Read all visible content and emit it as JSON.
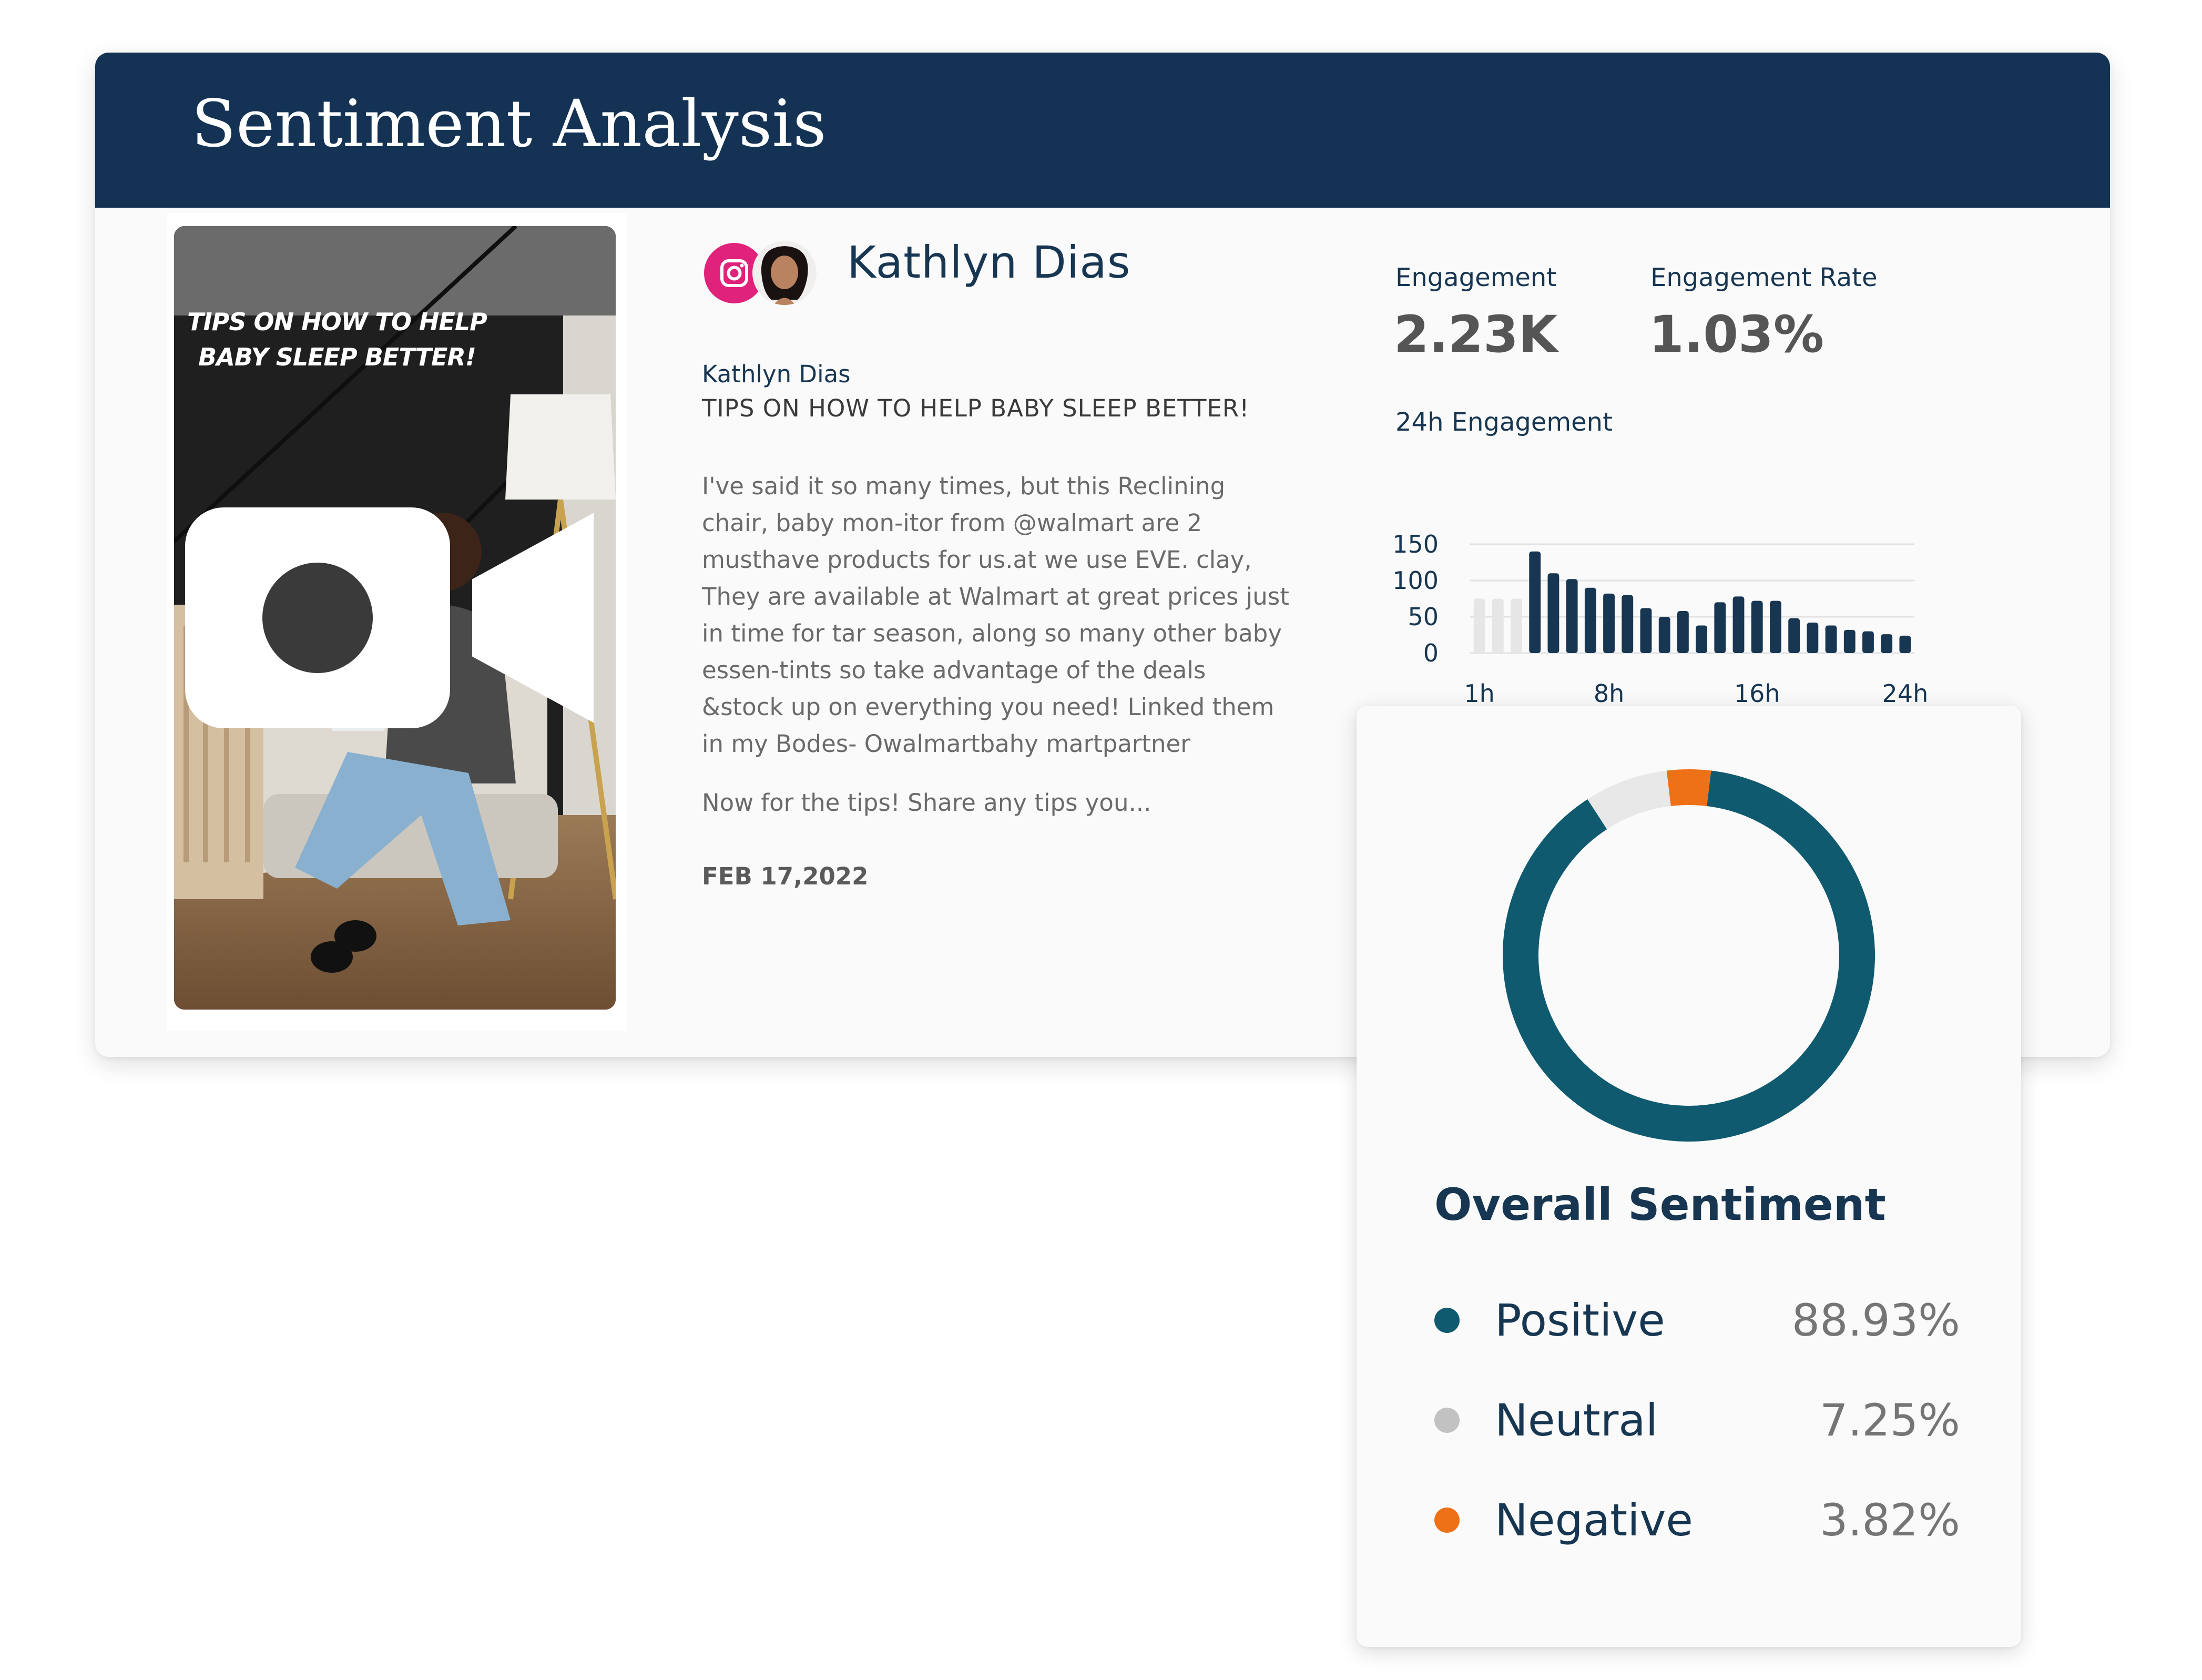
{
  "header": {
    "title": "Sentiment Analysis"
  },
  "thumbnail": {
    "overlay_line1": "TIPS ON HOW TO HELP",
    "overlay_line2": "BABY SLEEP BETTER!",
    "video_icon": "video-camera-icon"
  },
  "profile": {
    "platform_icon": "instagram-icon",
    "name": "Kathlyn Dias"
  },
  "post": {
    "author": "Kathlyn Dias",
    "headline": "TIPS ON HOW TO HELP BABY SLEEP BETTER!",
    "body_lines": [
      "I've said it so many times, but this Reclining",
      "chair, baby mon-itor from @walmart are 2",
      "musthave products for us.at we use EVE. clay,",
      "They are available at Walmart at great prices just",
      "in time for tar season, along so many other baby",
      "essen-tints so take advantage of the deals",
      "&stock up on everything you need! Linked them",
      "in my Bodes- Owalmartbahy martpartner"
    ],
    "more": "Now for the tips! Share any tips you...",
    "date": "FEB 17,2022"
  },
  "stats": {
    "engagement_label": "Engagement",
    "engagement_value": "2.23K",
    "rate_label": "Engagement Rate",
    "rate_value": "1.03%"
  },
  "chart_data": [
    {
      "type": "bar",
      "title": "24h Engagement",
      "xlabel": "",
      "ylabel": "",
      "ylim": [
        0,
        150
      ],
      "yticks": [
        "150",
        "100",
        "50",
        "0"
      ],
      "xticks": [
        "1h",
        "8h",
        "16h",
        "24h"
      ],
      "categories": [
        "1h",
        "2h",
        "3h",
        "4h",
        "5h",
        "6h",
        "7h",
        "8h",
        "9h",
        "10h",
        "11h",
        "12h",
        "13h",
        "14h",
        "15h",
        "16h",
        "17h",
        "18h",
        "19h",
        "20h",
        "21h",
        "22h",
        "23h",
        "24h"
      ],
      "values": [
        75,
        75,
        75,
        140,
        110,
        102,
        90,
        82,
        80,
        62,
        50,
        58,
        38,
        70,
        78,
        72,
        72,
        48,
        42,
        38,
        32,
        30,
        26,
        24
      ],
      "colors": [
        "#e6e6e6",
        "#e6e6e6",
        "#e6e6e6",
        "#173652",
        "#173652",
        "#173652",
        "#173652",
        "#173652",
        "#173652",
        "#173652",
        "#173652",
        "#173652",
        "#173652",
        "#173652",
        "#173652",
        "#173652",
        "#173652",
        "#173652",
        "#173652",
        "#173652",
        "#173652",
        "#173652",
        "#173652",
        "#173652"
      ]
    },
    {
      "type": "pie",
      "title": "Overall Sentiment",
      "categories": [
        "Positive",
        "Neutral",
        "Negative"
      ],
      "values": [
        88.93,
        7.25,
        3.82
      ],
      "labels": [
        "88.93%",
        "7.25%",
        "3.82%"
      ],
      "colors": [
        "#0f5a6e",
        "#e8e8e8",
        "#ee7118"
      ],
      "legend_dot_colors": [
        "#0f5a6e",
        "#c2c2c2",
        "#ee7118"
      ]
    }
  ]
}
